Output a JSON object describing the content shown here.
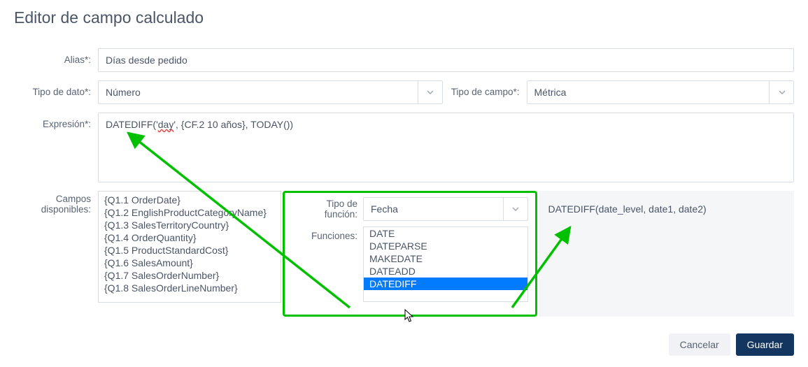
{
  "title": "Editor de campo calculado",
  "labels": {
    "alias": "Alias*:",
    "dataType": "Tipo de dato*:",
    "fieldType": "Tipo de campo*:",
    "expression": "Expresión*:",
    "available": "Campos disponibles:",
    "funcType": "Tipo de función:",
    "functions": "Funciones:"
  },
  "values": {
    "alias": "Días desde pedido",
    "dataType": "Número",
    "fieldType": "Métrica",
    "expressionPrefix": "DATEDIFF('",
    "expressionWord": "day",
    "expressionSuffix": "', {CF.2 10 años}, TODAY())",
    "funcType": "Fecha",
    "signature": "DATEDIFF(date_level, date1, date2)"
  },
  "availableFields": [
    "{Q1.1 OrderDate}",
    "{Q1.2 EnglishProductCategoryName}",
    "{Q1.3 SalesTerritoryCountry}",
    "{Q1.4 OrderQuantity}",
    "{Q1.5 ProductStandardCost}",
    "{Q1.6 SalesAmount}",
    "{Q1.7 SalesOrderNumber}",
    "{Q1.8 SalesOrderLineNumber}"
  ],
  "functions": [
    {
      "name": "DATE",
      "selected": false
    },
    {
      "name": "DATEPARSE",
      "selected": false
    },
    {
      "name": "MAKEDATE",
      "selected": false
    },
    {
      "name": "DATEADD",
      "selected": false
    },
    {
      "name": "DATEDIFF",
      "selected": true
    }
  ],
  "buttons": {
    "cancel": "Cancelar",
    "save": "Guardar"
  },
  "colors": {
    "annotation": "#00c000",
    "primary": "#12365f",
    "selected": "#027bff"
  }
}
